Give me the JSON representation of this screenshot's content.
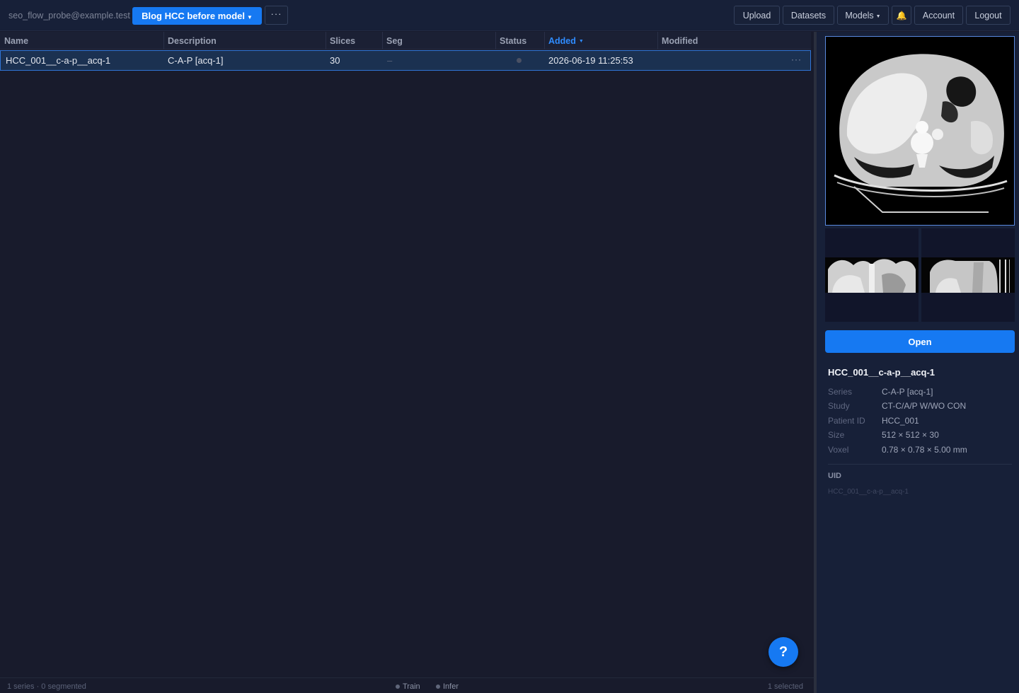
{
  "header": {
    "user_email": "seo_flow_probe@example.test",
    "project_label": "Blog HCC before model",
    "more_label": "···",
    "nav": {
      "upload": "Upload",
      "datasets": "Datasets",
      "models": "Models",
      "account": "Account",
      "logout": "Logout"
    },
    "bell_icon": "bell-icon"
  },
  "table": {
    "columns": [
      "Name",
      "Description",
      "Slices",
      "Seg",
      "Status",
      "Added",
      "Modified"
    ],
    "sorted_column": "Added",
    "sort_direction": "descending",
    "rows": [
      {
        "name": "HCC_001__c-a-p__acq-1",
        "description": "C-A-P [acq-1]",
        "slices": "30",
        "seg": "–",
        "status": "",
        "added": "2026-06-19 11:25:53",
        "modified": "",
        "menu": "···"
      }
    ]
  },
  "panel": {
    "open_label": "Open",
    "title": "HCC_001__c-a-p__acq-1",
    "meta": [
      {
        "label": "Series",
        "value": "C-A-P [acq-1]"
      },
      {
        "label": "Study",
        "value": "CT-C/A/P W/WO CON"
      },
      {
        "label": "Patient ID",
        "value": "HCC_001"
      },
      {
        "label": "Size",
        "value": "512 × 512 × 30"
      },
      {
        "label": "Voxel",
        "value": "0.78 × 0.78 × 5.00 mm"
      }
    ],
    "uid_label": "UID",
    "uid_value": "HCC_001__c-a-p__acq-1"
  },
  "statusbar": {
    "summary": "1 series · 0 segmented",
    "train": "Train",
    "infer": "Infer",
    "selected": "1 selected"
  },
  "help_label": "?",
  "colors": {
    "accent": "#1679f2",
    "background": "#181b2c",
    "panel": "#172038",
    "selected_row": "#1b3151"
  }
}
